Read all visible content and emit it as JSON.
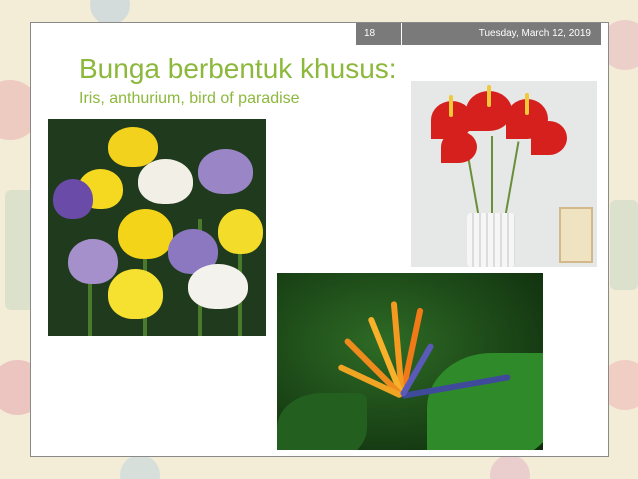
{
  "slide": {
    "number": "18",
    "date": "Tuesday, March 12, 2019",
    "title": "Bunga berbentuk khusus:",
    "subtitle": "Iris, anthurium, bird of paradise"
  },
  "photos": [
    {
      "name": "iris-photo"
    },
    {
      "name": "anthurium-photo"
    },
    {
      "name": "bird-of-paradise-photo"
    }
  ],
  "colors": {
    "title": "#8cb83c",
    "header_bar": "#7a7a7a"
  }
}
